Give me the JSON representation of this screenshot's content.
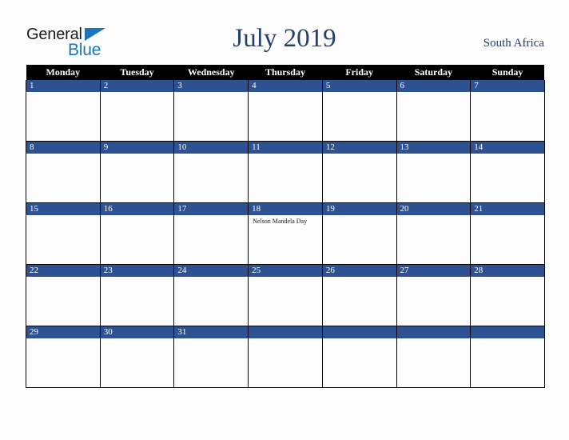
{
  "logo": {
    "word_one": "General",
    "word_two": "Blue",
    "triangle_icon": "triangle-icon",
    "brand_blue": "#1b75bc"
  },
  "header": {
    "title": "July 2019",
    "country": "South Africa",
    "title_color": "#24406e"
  },
  "calendar": {
    "header_background": "#000000",
    "day_bar_color": "#2e5291",
    "grid_line_color": "#000000",
    "weekdays": [
      "Monday",
      "Tuesday",
      "Wednesday",
      "Thursday",
      "Friday",
      "Saturday",
      "Sunday"
    ],
    "weeks": [
      [
        {
          "day": "1",
          "events": []
        },
        {
          "day": "2",
          "events": []
        },
        {
          "day": "3",
          "events": []
        },
        {
          "day": "4",
          "events": []
        },
        {
          "day": "5",
          "events": []
        },
        {
          "day": "6",
          "events": []
        },
        {
          "day": "7",
          "events": []
        }
      ],
      [
        {
          "day": "8",
          "events": []
        },
        {
          "day": "9",
          "events": []
        },
        {
          "day": "10",
          "events": []
        },
        {
          "day": "11",
          "events": []
        },
        {
          "day": "12",
          "events": []
        },
        {
          "day": "13",
          "events": []
        },
        {
          "day": "14",
          "events": []
        }
      ],
      [
        {
          "day": "15",
          "events": []
        },
        {
          "day": "16",
          "events": []
        },
        {
          "day": "17",
          "events": []
        },
        {
          "day": "18",
          "events": [
            "Nelson Mandela Day"
          ]
        },
        {
          "day": "19",
          "events": []
        },
        {
          "day": "20",
          "events": []
        },
        {
          "day": "21",
          "events": []
        }
      ],
      [
        {
          "day": "22",
          "events": []
        },
        {
          "day": "23",
          "events": []
        },
        {
          "day": "24",
          "events": []
        },
        {
          "day": "25",
          "events": []
        },
        {
          "day": "26",
          "events": []
        },
        {
          "day": "27",
          "events": []
        },
        {
          "day": "28",
          "events": []
        }
      ],
      [
        {
          "day": "29",
          "events": []
        },
        {
          "day": "30",
          "events": []
        },
        {
          "day": "31",
          "events": []
        },
        {
          "day": "",
          "events": []
        },
        {
          "day": "",
          "events": []
        },
        {
          "day": "",
          "events": []
        },
        {
          "day": "",
          "events": []
        }
      ]
    ]
  }
}
